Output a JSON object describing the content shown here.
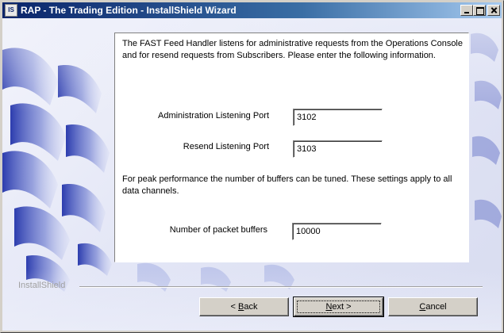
{
  "window": {
    "title": "RAP - The Trading Edition - InstallShield Wizard",
    "icon": "installshield-app-icon",
    "icon_text": "IS"
  },
  "content": {
    "intro_text": "The FAST Feed Handler listens for administrative requests from the Operations Console and for resend requests from Subscribers.  Please enter the following information.",
    "fields": [
      {
        "label": "Administration Listening Port",
        "value": "3102"
      },
      {
        "label": "Resend Listening Port",
        "value": "3103"
      }
    ],
    "buffers_text": "For peak performance the number of buffers can be tuned.  These settings apply to all data channels.",
    "buffer_field": {
      "label": "Number of packet buffers",
      "value": "10000"
    }
  },
  "footer": {
    "brand": "InstallShield",
    "buttons": {
      "back": {
        "prefix": "< ",
        "mnemonic": "B",
        "rest": "ack"
      },
      "next": {
        "mnemonic": "N",
        "rest": "ext >"
      },
      "cancel": {
        "mnemonic": "C",
        "rest": "ancel"
      }
    }
  },
  "colors": {
    "titlebar_start": "#0a246a",
    "titlebar_end": "#a6caf0",
    "decor_blue": "#2f3fb0"
  }
}
